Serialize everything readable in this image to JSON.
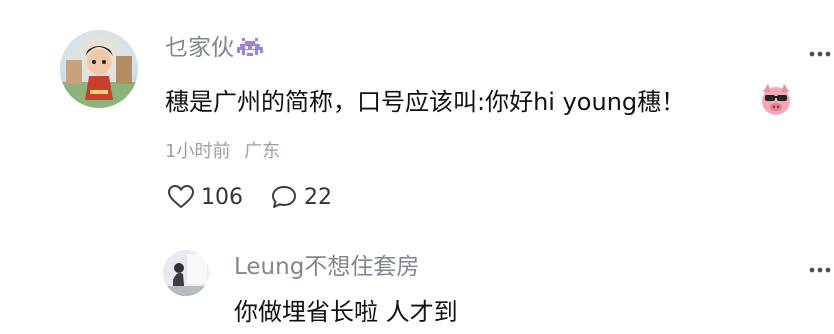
{
  "comment": {
    "username": "乜家伙",
    "badge_icon": "pixel-invader-icon",
    "text": "穗是广州的简称，口号应该叫:你好hi young穗！",
    "emoji_icon": "pig-sunglasses-emoji-icon",
    "time": "1小时前",
    "location": "广东",
    "likes": "106",
    "replies": "22",
    "more_icon": "vertical-dots-icon"
  },
  "reply": {
    "username": "Leung不想住套房",
    "text": "你做埋省长啦 人才到",
    "more_icon": "vertical-dots-icon"
  },
  "colors": {
    "meta_text": "#9aa1a8",
    "username_text": "#7f8790",
    "body_text": "#111111",
    "icon_stroke": "#3a3f45"
  }
}
